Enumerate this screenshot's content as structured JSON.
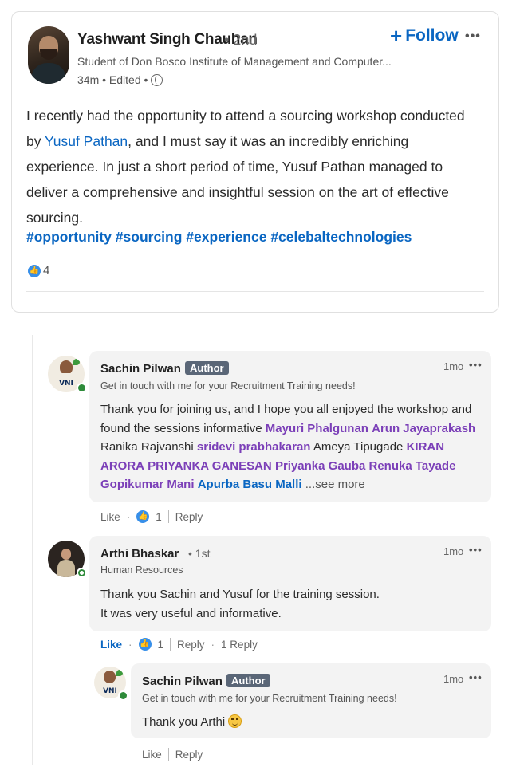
{
  "post": {
    "author": "Yashwant Singh Chauhan",
    "degree": "• 2nd",
    "headline": "Student of Don Bosco Institute of Management and Computer...",
    "meta": "34m • Edited •",
    "follow_label": "Follow",
    "more": "•••",
    "text_1": "I recently had the opportunity to attend a sourcing workshop conducted by ",
    "mention": "Yusuf Pathan",
    "text_2": ", and I must say it was an incredibly enriching experience. In just a short period of time, Yusuf Pathan managed to deliver a comprehensive and insightful session on the art of effective sourcing.",
    "hashtags": "#opportunity #sourcing #experience #celebaltechnologies",
    "reaction_count": "4"
  },
  "comments": [
    {
      "name": "Sachin Pilwan",
      "badge": "Author",
      "headline": "Get in touch with me for your Recruitment Training needs!",
      "time": "1mo",
      "more": "•••",
      "text_1": "Thank you for joining us, and I hope you all enjoyed the workshop and found the sessions informative ",
      "m1": "Mayuri Phalgunan",
      "m2": "Arun Jayaprakash",
      "t2": " Ranika Rajvanshi ",
      "m3": "sridevi prabhakaran",
      "t3": " Ameya Tipugade ",
      "m4": "KIRAN ARORA",
      "m5": "PRIYANKA GANESAN",
      "m6": "Priyanka Gauba",
      "m7": "Renuka Tayade",
      "m8": "Gopikumar Mani",
      "m9": "Apurba Basu Malli",
      "see_more": "...see more",
      "like": "Like",
      "count": "1",
      "reply": "Reply"
    },
    {
      "name": "Arthi Bhaskar",
      "degree": "• 1st",
      "headline": "Human Resources",
      "time": "1mo",
      "more": "•••",
      "line1": "Thank you Sachin and Yusuf for the training session.",
      "line2": "It was very useful and informative.",
      "like": "Like",
      "count": "1",
      "reply": "Reply",
      "replies": "1 Reply"
    },
    {
      "name": "Sachin Pilwan",
      "badge": "Author",
      "headline": "Get in touch with me for your Recruitment Training needs!",
      "time": "1mo",
      "more": "•••",
      "text": "Thank you Arthi",
      "like": "Like",
      "reply": "Reply"
    }
  ],
  "icons": {
    "globe": "globe-icon",
    "like_reaction": "like-reaction-icon",
    "smile_emoji": "smiling-face-emoji"
  },
  "colors": {
    "link": "#0a66c2",
    "mention_purple": "#7b3fb8",
    "author_badge": "#5a6677",
    "online": "#2e8b3a"
  }
}
